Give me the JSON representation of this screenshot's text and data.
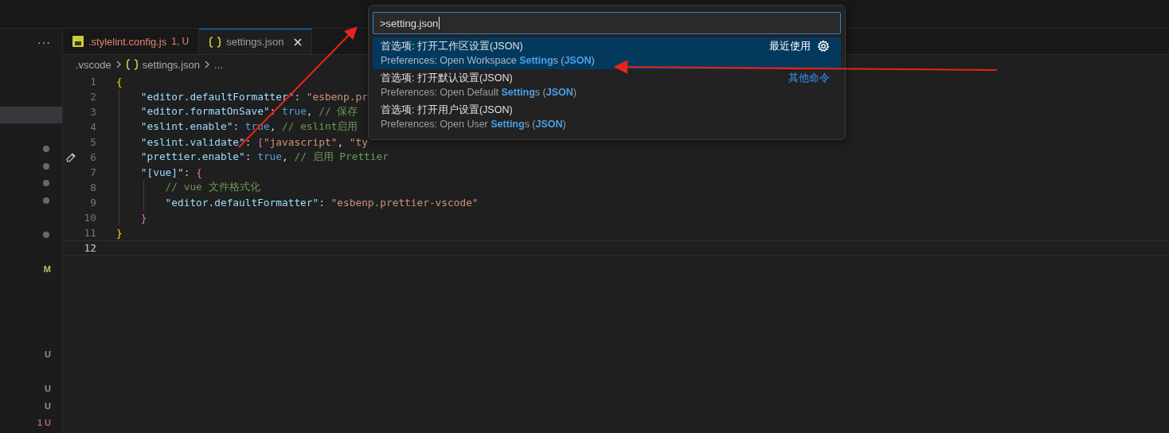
{
  "sidebar": {
    "more": "···",
    "rows": [
      {
        "kind": "blank",
        "selected": false
      },
      {
        "kind": "blank",
        "selected": false
      },
      {
        "kind": "blank",
        "selected": false
      },
      {
        "kind": "blank",
        "selected": true
      },
      {
        "kind": "blank",
        "selected": false
      },
      {
        "kind": "dot",
        "selected": false
      },
      {
        "kind": "dot",
        "selected": false
      },
      {
        "kind": "dot",
        "selected": false
      },
      {
        "kind": "dot",
        "selected": false
      },
      {
        "kind": "blank",
        "selected": false
      },
      {
        "kind": "dot",
        "selected": false
      },
      {
        "kind": "blank",
        "selected": false
      },
      {
        "kind": "badge",
        "text": "M",
        "color": "#c9b877",
        "selected": false
      },
      {
        "kind": "blank",
        "selected": false
      },
      {
        "kind": "blank",
        "selected": false
      },
      {
        "kind": "blank",
        "selected": false
      },
      {
        "kind": "blank",
        "selected": false
      },
      {
        "kind": "badge",
        "text": "U",
        "color": "#7f9f86",
        "selected": false
      },
      {
        "kind": "blank",
        "selected": false
      },
      {
        "kind": "badge",
        "text": "U",
        "color": "#7f9f86",
        "selected": false
      },
      {
        "kind": "badge",
        "text": "U",
        "color": "#7f9f86",
        "selected": false
      },
      {
        "kind": "badge",
        "text": "1 U",
        "color": "#b5646a",
        "selected": false
      }
    ]
  },
  "tabs": [
    {
      "label": ".stylelint.config.js",
      "status": "1, U",
      "selected": false
    },
    {
      "label": "settings.json",
      "selected": true
    }
  ],
  "breadcrumb": [
    {
      "text": ".vscode"
    },
    {
      "text": "settings.json"
    },
    {
      "text": "..."
    }
  ],
  "code": [
    {
      "number": "1",
      "current": false,
      "tokens": [
        {
          "kind": "brace1",
          "text": "{"
        }
      ],
      "children": [
        {
          "number": "2",
          "current": false,
          "tokens": [
            {
              "kind": "key",
              "text": "\"editor.defaultFormatter\""
            },
            {
              "kind": "punc",
              "text": ": "
            },
            {
              "kind": "str",
              "text": "\"esbenp.pr"
            }
          ]
        },
        {
          "number": "3",
          "current": false,
          "tokens": [
            {
              "kind": "key",
              "text": "\"editor.formatOnSave\""
            },
            {
              "kind": "punc",
              "text": ": "
            },
            {
              "kind": "kw",
              "text": "true"
            },
            {
              "kind": "punc",
              "text": ", "
            },
            {
              "kind": "com",
              "text": "// 保存"
            }
          ]
        },
        {
          "number": "4",
          "current": false,
          "tokens": [
            {
              "kind": "key",
              "text": "\"eslint.enable\""
            },
            {
              "kind": "punc",
              "text": ": "
            },
            {
              "kind": "kw",
              "text": "true"
            },
            {
              "kind": "punc",
              "text": ", "
            },
            {
              "kind": "com",
              "text": "// eslint启用"
            }
          ]
        },
        {
          "number": "5",
          "current": false,
          "tokens": [
            {
              "kind": "key",
              "text": "\"eslint.validate\""
            },
            {
              "kind": "punc",
              "text": ": "
            },
            {
              "kind": "brace2",
              "text": "["
            },
            {
              "kind": "str",
              "text": "\"javascript\""
            },
            {
              "kind": "punc",
              "text": ", "
            },
            {
              "kind": "str",
              "text": "\"ty"
            }
          ]
        },
        {
          "number": "6",
          "current": false,
          "edited": true,
          "tokens": [
            {
              "kind": "key",
              "text": "\"prettier.enable\""
            },
            {
              "kind": "punc",
              "text": ": "
            },
            {
              "kind": "kw",
              "text": "true"
            },
            {
              "kind": "punc",
              "text": ", "
            },
            {
              "kind": "com",
              "text": "// 启用 Prettier"
            }
          ]
        },
        {
          "number": "7",
          "current": false,
          "tokens": [
            {
              "kind": "key",
              "text": "\"[vue]\""
            },
            {
              "kind": "punc",
              "text": ": "
            },
            {
              "kind": "brace2",
              "text": "{"
            }
          ],
          "children": [
            {
              "number": "8",
              "current": false,
              "tokens": [
                {
                  "kind": "com",
                  "text": "// vue 文件格式化"
                }
              ]
            },
            {
              "number": "9",
              "current": false,
              "tokens": [
                {
                  "kind": "key",
                  "text": "\"editor.defaultFormatter\""
                },
                {
                  "kind": "punc",
                  "text": ": "
                },
                {
                  "kind": "str",
                  "text": "\"esbenp.prettier-vscode\""
                }
              ]
            }
          ]
        },
        {
          "number": "10",
          "current": false,
          "tokens": [
            {
              "kind": "brace2",
              "text": "}"
            }
          ]
        }
      ]
    },
    {
      "number": "11",
      "current": false,
      "tokens": [
        {
          "kind": "brace1",
          "text": "}"
        }
      ]
    },
    {
      "number": "12",
      "current": true
    }
  ],
  "palette": {
    "value": ">setting.json",
    "items": [
      {
        "label": "首选项: 打开工作区设置(JSON)",
        "description": [
          {
            "text": "Preferences: Open Workspace ",
            "match": false
          },
          {
            "text": "Setting",
            "match": true
          },
          {
            "text": "s (",
            "match": false
          },
          {
            "text": "JSON",
            "match": true
          },
          {
            "text": ")",
            "match": false
          }
        ],
        "tag": "最近使用",
        "gear": true,
        "selected": true
      },
      {
        "label": "首选项: 打开默认设置(JSON)",
        "description": [
          {
            "text": "Preferences: Open Default ",
            "match": false
          },
          {
            "text": "Setting",
            "match": true
          },
          {
            "text": "s (",
            "match": false
          },
          {
            "text": "JSON",
            "match": true
          },
          {
            "text": ")",
            "match": false
          }
        ],
        "link": "其他命令",
        "selected": false
      },
      {
        "label": "首选项: 打开用户设置(JSON)",
        "description": [
          {
            "text": "Preferences: Open User ",
            "match": false
          },
          {
            "text": "Setting",
            "match": true
          },
          {
            "text": "s (",
            "match": false
          },
          {
            "text": "JSON",
            "match": true
          },
          {
            "text": ")",
            "match": false
          }
        ],
        "selected": false
      }
    ]
  }
}
